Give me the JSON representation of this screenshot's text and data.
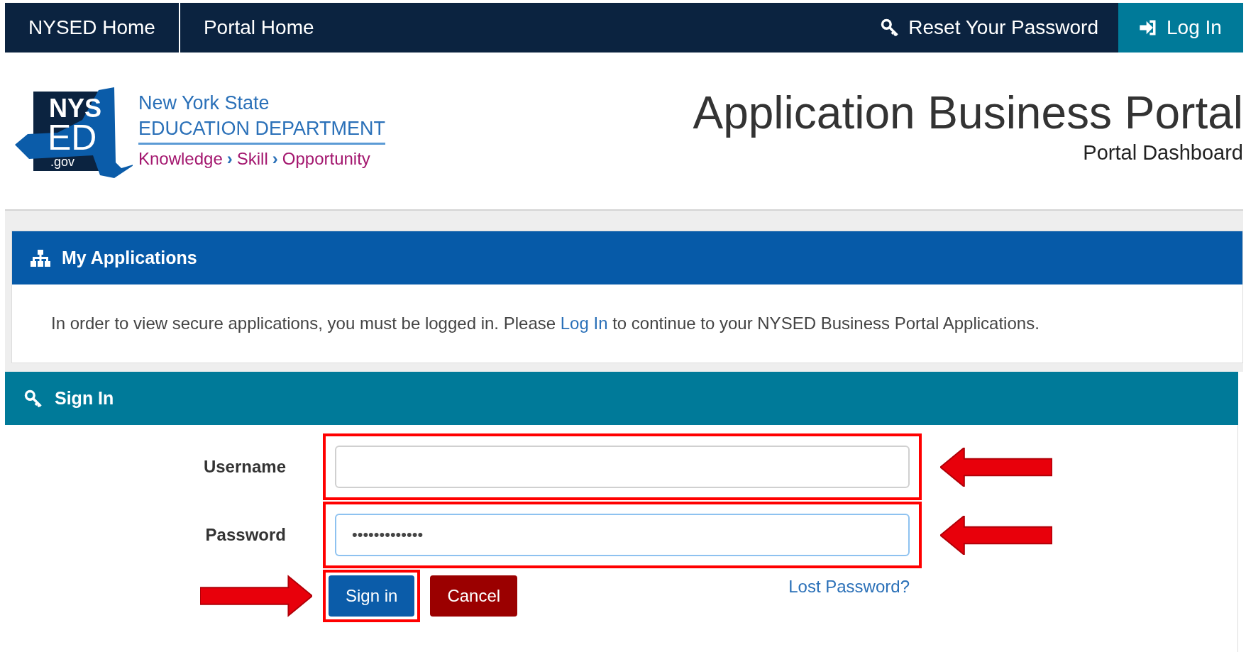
{
  "nav": {
    "left": [
      "NYSED Home",
      "Portal Home"
    ],
    "reset": "Reset Your Password",
    "login": "Log In"
  },
  "logo": {
    "mark": [
      "NYS",
      "ED",
      ".gov"
    ],
    "line1": "New York State",
    "line2": "EDUCATION DEPARTMENT",
    "tagline": [
      "Knowledge",
      "›",
      "Skill",
      "›",
      "Opportunity"
    ]
  },
  "header": {
    "title": "Application Business Portal",
    "subtitle": "Portal Dashboard"
  },
  "applications": {
    "title": "My Applications",
    "text_before": "In order to view secure applications, you must be logged in. Please",
    "link": "Log In",
    "text_after": "to continue to your NYSED Business Portal Applications."
  },
  "sign_in": {
    "title": "Sign In",
    "fields": [
      {
        "label": "Username",
        "focused": false,
        "highlighted": true
      },
      {
        "label": "Password",
        "value": "•••••••••••••",
        "focused": true,
        "highlighted": true
      }
    ],
    "buttons": [
      {
        "label": "Sign in",
        "kind": "primary",
        "highlighted": true
      },
      {
        "label": "Cancel",
        "kind": "danger",
        "highlighted": false
      }
    ],
    "lost_password": "Lost Password?"
  }
}
